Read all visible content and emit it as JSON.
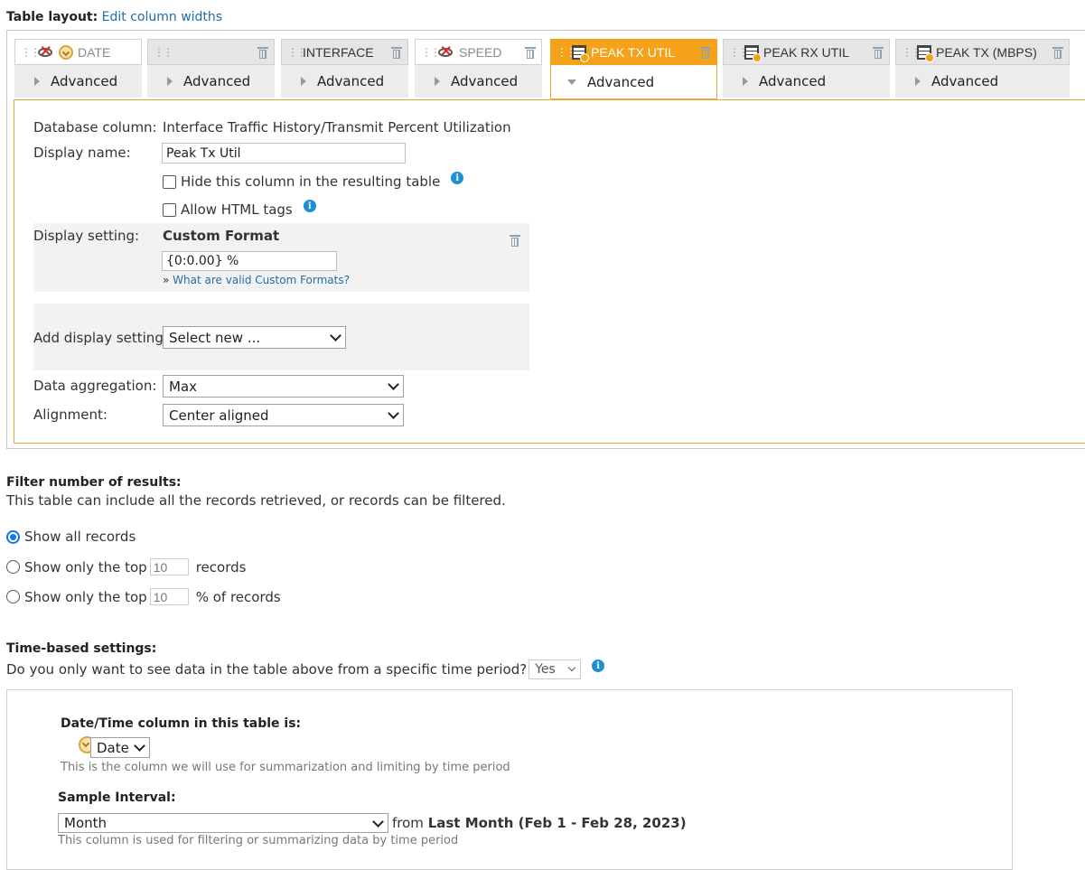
{
  "header": {
    "title": "Table layout:",
    "edit_link": "Edit column widths"
  },
  "columns": [
    {
      "name": "DATE",
      "advanced": "Advanced",
      "hidden": true,
      "icon": "clock-icon",
      "deletable": false
    },
    {
      "name": "",
      "advanced": "Advanced",
      "hidden": false,
      "icon": "",
      "deletable": true
    },
    {
      "name": "INTERFACE",
      "advanced": "Advanced",
      "hidden": false,
      "icon": "",
      "deletable": true
    },
    {
      "name": "SPEED",
      "advanced": "Advanced",
      "hidden": true,
      "icon": "",
      "deletable": true
    },
    {
      "name": "PEAK TX UTIL",
      "advanced": "Advanced",
      "hidden": false,
      "icon": "table-icon",
      "deletable": true,
      "active": true
    },
    {
      "name": "PEAK RX UTIL",
      "advanced": "Advanced",
      "hidden": false,
      "icon": "table-icon",
      "deletable": true
    },
    {
      "name": "PEAK TX (MBPS)",
      "advanced": "Advanced",
      "hidden": false,
      "icon": "table-icon",
      "deletable": true
    }
  ],
  "editor": {
    "db_column_label": "Database column:",
    "db_column_value": "Interface Traffic History/Transmit Percent Utilization",
    "display_name_label": "Display name:",
    "display_name_value": "Peak Tx Util",
    "hide_column_label": "Hide this column in the resulting table",
    "allow_html_label": "Allow HTML tags",
    "display_setting_label": "Display setting:",
    "custom_format_title": "Custom Format",
    "custom_format_value": "{0:0.00} %",
    "custom_format_link_prefix": "»",
    "custom_format_link": "What are valid Custom Formats?",
    "add_display_label": "Add display settings:",
    "add_display_value": "Select new ...",
    "aggregation_label": "Data aggregation:",
    "aggregation_value": "Max",
    "alignment_label": "Alignment:",
    "alignment_value": "Center aligned"
  },
  "filter": {
    "title": "Filter number of results:",
    "description": "This table can include all the records retrieved, or records can be filtered.",
    "option_all": "Show all records",
    "option_top_prefix": "Show only the top",
    "option_top_value": "10",
    "option_top_suffix": "records",
    "option_pct_prefix": "Show only the top",
    "option_pct_value": "10",
    "option_pct_suffix": "% of records"
  },
  "time": {
    "title": "Time-based settings:",
    "question": "Do you only want to see data in the table above from a specific time period?",
    "question_value": "Yes",
    "datetime_title": "Date/Time column in this table is:",
    "datetime_value": "Date",
    "datetime_hint": "This is the column we will use for summarization and limiting by time period",
    "interval_title": "Sample Interval:",
    "interval_value": "Month",
    "interval_from": "from",
    "interval_range": "Last Month (Feb 1 - Feb 28, 2023)",
    "interval_hint": "This column is used for filtering or summarizing data by time period"
  },
  "colors": {
    "accent": "#f5a21a",
    "link": "#1f6da8",
    "radio": "#1473e6",
    "info": "#1c8fd6"
  }
}
